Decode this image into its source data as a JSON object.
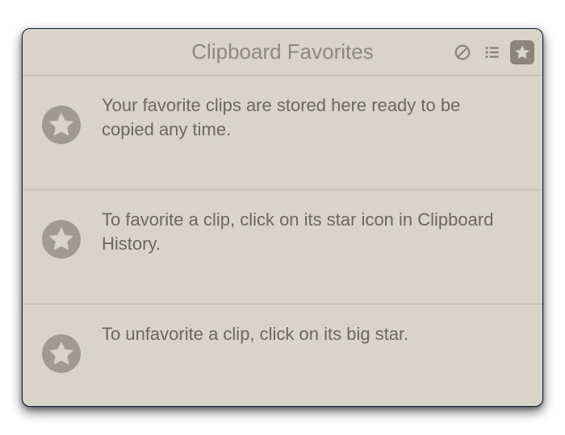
{
  "header": {
    "title": "Clipboard Favorites"
  },
  "rows": [
    {
      "text": "Your favorite clips are stored here ready to be copied any time."
    },
    {
      "text": "To favorite a clip, click on its star icon in Clipboard History."
    },
    {
      "text": "To unfavorite a clip, click on its big star."
    }
  ]
}
